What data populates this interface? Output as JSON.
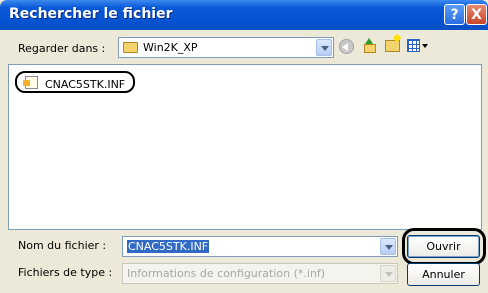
{
  "window": {
    "title": "Rechercher le fichier",
    "help_glyph": "?",
    "close_glyph": "X"
  },
  "lookin": {
    "label": "Regarder dans :",
    "value": "Win2K_XP"
  },
  "toolbar": {
    "icons": [
      "back-icon",
      "up-folder-icon",
      "new-folder-icon",
      "views-menu-icon"
    ]
  },
  "files": [
    {
      "name": "CNAC5STK.INF",
      "icon": "inf-file-icon"
    }
  ],
  "filename": {
    "label": "Nom du fichier :",
    "value": "CNAC5STK.INF"
  },
  "filetype": {
    "label": "Fichiers de type :",
    "value": "Informations de configuration (*.inf)"
  },
  "buttons": {
    "open": "Ouvrir",
    "cancel": "Annuler"
  },
  "colors": {
    "titlebar": "#0553d0",
    "selection": "#316ac5",
    "dialog_bg": "#ece9d8"
  }
}
